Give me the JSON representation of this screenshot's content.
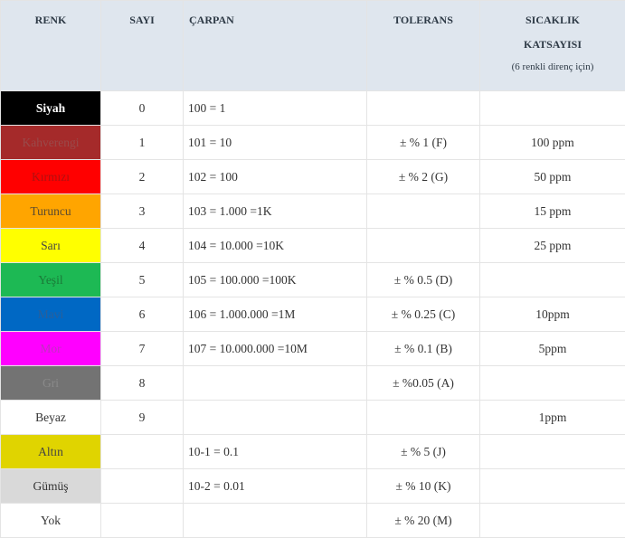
{
  "headers": {
    "color": "RENK",
    "number": "SAYI",
    "multiplier": "ÇARPAN",
    "tolerance": "TOLERANS",
    "temp_line1": "SICAKLIK",
    "temp_line2": "KATSAYISI",
    "temp_note": "(6 renkli direnç için)"
  },
  "rows": [
    {
      "name": "Siyah",
      "bg": "#000000",
      "fg": "#ffffff",
      "bold": true,
      "number": "0",
      "multiplier": "100 = 1",
      "tolerance": "",
      "temp": ""
    },
    {
      "name": "Kahverengi",
      "bg": "#a52a2a",
      "fg": "#9a4a4a",
      "bold": false,
      "number": "1",
      "multiplier": "101 = 10",
      "tolerance": "± % 1 (F)",
      "temp": "100 ppm"
    },
    {
      "name": "Kırmızı",
      "bg": "#ff0000",
      "fg": "#b01010",
      "bold": false,
      "number": "2",
      "multiplier": "102 = 100",
      "tolerance": "± % 2 (G)",
      "temp": "50 ppm"
    },
    {
      "name": "Turuncu",
      "bg": "#ffa500",
      "fg": "#5a4a30",
      "bold": false,
      "number": "3",
      "multiplier": "103 = 1.000 =1K",
      "tolerance": "",
      "temp": "15 ppm"
    },
    {
      "name": "Sarı",
      "bg": "#ffff00",
      "fg": "#444444",
      "bold": false,
      "number": "4",
      "multiplier": "104 = 10.000 =10K",
      "tolerance": "",
      "temp": "25 ppm"
    },
    {
      "name": "Yeşil",
      "bg": "#1db954",
      "fg": "#1a7a38",
      "bold": false,
      "number": "5",
      "multiplier": "105 = 100.000 =100K",
      "tolerance": "± % 0.5 (D)",
      "temp": ""
    },
    {
      "name": "Mavi",
      "bg": "#0068c4",
      "fg": "#2a5f9a",
      "bold": false,
      "number": "6",
      "multiplier": "106 = 1.000.000 =1M",
      "tolerance": "± % 0.25 (C)",
      "temp": "10ppm"
    },
    {
      "name": "Mor",
      "bg": "#ff00ff",
      "fg": "#c030c0",
      "bold": false,
      "number": "7",
      "multiplier": "107 = 10.000.000 =10M",
      "tolerance": "± % 0.1 (B)",
      "temp": "5ppm"
    },
    {
      "name": "Gri",
      "bg": "#737373",
      "fg": "#8a8a8a",
      "bold": false,
      "number": "8",
      "multiplier": "",
      "tolerance": "± %0.05 (A)",
      "temp": ""
    },
    {
      "name": "Beyaz",
      "bg": "#ffffff",
      "fg": "#333333",
      "bold": false,
      "number": "9",
      "multiplier": "",
      "tolerance": "",
      "temp": "1ppm"
    },
    {
      "name": "Altın",
      "bg": "#e0d400",
      "fg": "#444444",
      "bold": false,
      "number": "",
      "multiplier": "10-1 = 0.1",
      "tolerance": "± % 5 (J)",
      "temp": ""
    },
    {
      "name": "Gümüş",
      "bg": "#d9d9d9",
      "fg": "#333333",
      "bold": false,
      "number": "",
      "multiplier": "10-2 = 0.01",
      "tolerance": "± % 10 (K)",
      "temp": ""
    },
    {
      "name": "Yok",
      "bg": "#ffffff",
      "fg": "#333333",
      "bold": false,
      "number": "",
      "multiplier": "",
      "tolerance": "± % 20 (M)",
      "temp": ""
    }
  ]
}
